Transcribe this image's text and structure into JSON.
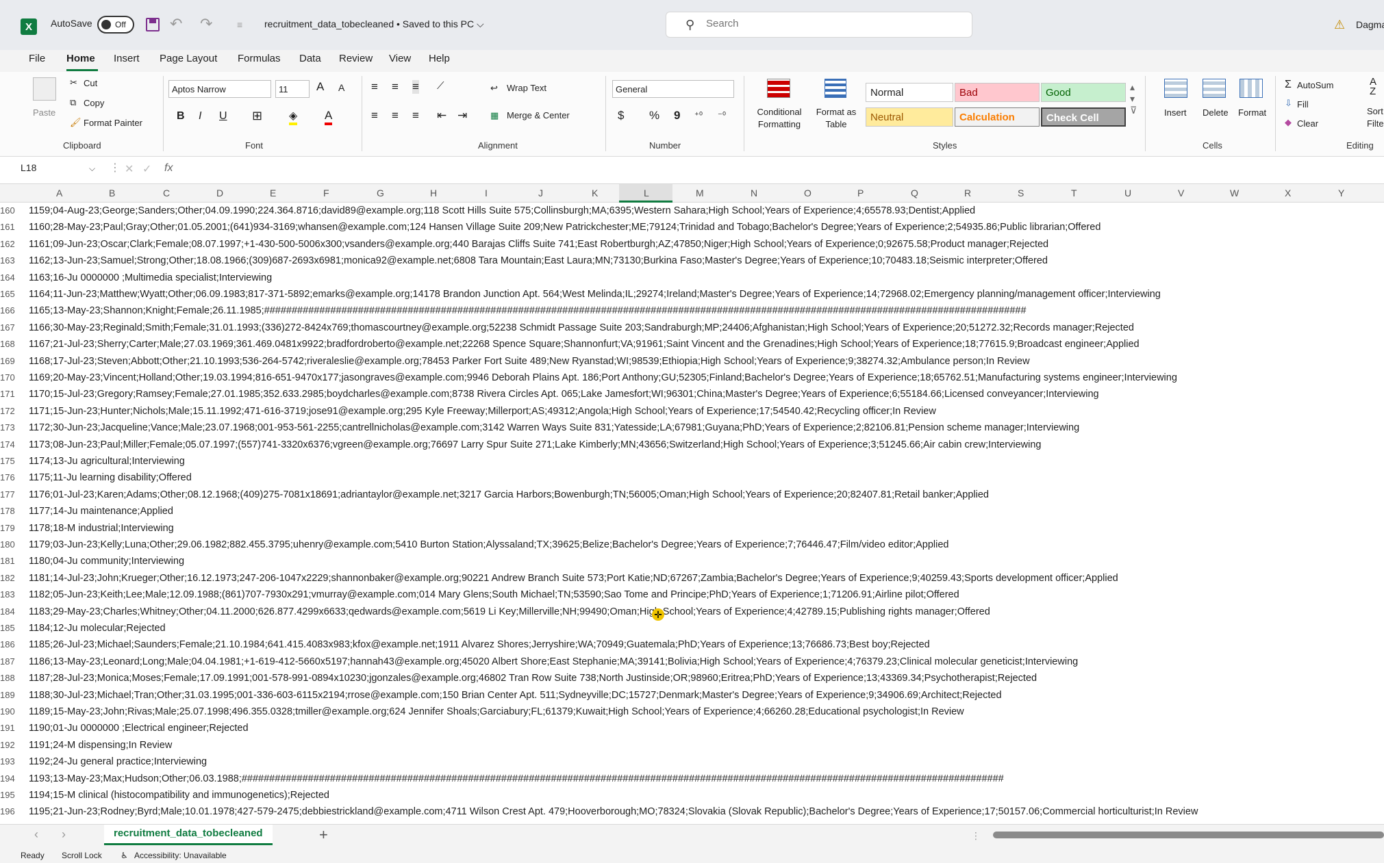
{
  "titlebar": {
    "app_icon": "X",
    "autosave": "AutoSave",
    "toggle": "Off",
    "doc_title": "recruitment_data_tobecleaned • Saved to this PC ⌵",
    "search_placeholder": "Search",
    "user": "Dagma",
    "warning_icon": "warning-icon"
  },
  "menu": [
    "File",
    "Home",
    "Insert",
    "Page Layout",
    "Formulas",
    "Data",
    "Review",
    "View",
    "Help"
  ],
  "ribbon": {
    "clipboard": {
      "paste": "Paste",
      "cut": "Cut",
      "copy": "Copy",
      "format_painter": "Format Painter",
      "label": "Clipboard"
    },
    "font": {
      "name": "Aptos Narrow",
      "size": "11",
      "label": "Font",
      "bold": "B",
      "italic": "I",
      "underline": "U",
      "grow": "A",
      "shrink": "A"
    },
    "alignment": {
      "wrap": "Wrap Text",
      "merge": "Merge & Center",
      "label": "Alignment"
    },
    "number": {
      "format": "General",
      "label": "Number",
      "currency": "$",
      "percent": "%",
      "comma": "9"
    },
    "styles": {
      "conditional": "Conditional Formatting",
      "table": "Format as Table",
      "normal": "Normal",
      "bad": "Bad",
      "good": "Good",
      "neutral": "Neutral",
      "calculation": "Calculation",
      "check": "Check Cell",
      "label": "Styles"
    },
    "cells": {
      "insert": "Insert",
      "delete": "Delete",
      "format": "Format",
      "label": "Cells"
    },
    "editing": {
      "autosum": "AutoSum",
      "fill": "Fill",
      "clear": "Clear",
      "sort": "Sort",
      "filter": "Filte",
      "label": "Editing"
    }
  },
  "formula": {
    "namebox": "L18",
    "fx": "fx",
    "value": ""
  },
  "columns": [
    "A",
    "B",
    "C",
    "D",
    "E",
    "F",
    "G",
    "H",
    "I",
    "J",
    "K",
    "L",
    "M",
    "N",
    "O",
    "P",
    "Q",
    "R",
    "S",
    "T",
    "U",
    "V",
    "W",
    "X",
    "Y"
  ],
  "rows": [
    {
      "n": "160",
      "t": "1159;04-Aug-23;George;Sanders;Other;04.09.1990;224.364.8716;david89@example.org;118 Scott Hills Suite 575;Collinsburgh;MA;6395;Western Sahara;High School;Years of Experience;4;65578.93;Dentist;Applied"
    },
    {
      "n": "161",
      "t": "1160;28-May-23;Paul;Gray;Other;01.05.2001;(641)934-3169;whansen@example.com;124 Hansen Village Suite 209;New Patrickchester;ME;79124;Trinidad and Tobago;Bachelor's Degree;Years of Experience;2;54935.86;Public librarian;Offered"
    },
    {
      "n": "162",
      "t": "1161;09-Jun-23;Oscar;Clark;Female;08.07.1997;+1-430-500-5006x300;vsanders@example.org;440 Barajas Cliffs Suite 741;East Robertburgh;AZ;47850;Niger;High School;Years of Experience;0;92675.58;Product manager;Rejected"
    },
    {
      "n": "163",
      "t": "1162;13-Jun-23;Samuel;Strong;Other;18.08.1966;(309)687-2693x6981;monica92@example.net;6808 Tara Mountain;East Laura;MN;73130;Burkina Faso;Master's Degree;Years of Experience;10;70483.18;Seismic interpreter;Offered"
    },
    {
      "n": "164",
      "t": "1163;16-Ju 0000000 ;Multimedia specialist;Interviewing"
    },
    {
      "n": "165",
      "t": "1164;11-Jun-23;Matthew;Wyatt;Other;06.09.1983;817-371-5892;emarks@example.org;14178 Brandon Junction Apt. 564;West Melinda;IL;29274;Ireland;Master's Degree;Years of Experience;14;72968.02;Emergency planning/management officer;Interviewing"
    },
    {
      "n": "166",
      "t": "1165;13-May-23;Shannon;Knight;Female;26.11.1985;##########################################################################################################################################"
    },
    {
      "n": "167",
      "t": "1166;30-May-23;Reginald;Smith;Female;31.01.1993;(336)272-8424x769;thomascourtney@example.org;52238 Schmidt Passage Suite 203;Sandraburgh;MP;24406;Afghanistan;High School;Years of Experience;20;51272.32;Records manager;Rejected"
    },
    {
      "n": "168",
      "t": "1167;21-Jul-23;Sherry;Carter;Male;27.03.1969;361.469.0481x9922;bradfordroberto@example.net;22268 Spence Square;Shannonfurt;VA;91961;Saint Vincent and the Grenadines;High School;Years of Experience;18;77615.9;Broadcast engineer;Applied"
    },
    {
      "n": "169",
      "t": "1168;17-Jul-23;Steven;Abbott;Other;21.10.1993;536-264-5742;riveraleslie@example.org;78453 Parker Fort Suite 489;New Ryanstad;WI;98539;Ethiopia;High School;Years of Experience;9;38274.32;Ambulance person;In Review"
    },
    {
      "n": "170",
      "t": "1169;20-May-23;Vincent;Holland;Other;19.03.1994;816-651-9470x177;jasongraves@example.com;9946 Deborah Plains Apt. 186;Port Anthony;GU;52305;Finland;Bachelor's Degree;Years of Experience;18;65762.51;Manufacturing systems engineer;Interviewing"
    },
    {
      "n": "171",
      "t": "1170;15-Jul-23;Gregory;Ramsey;Female;27.01.1985;352.633.2985;boydcharles@example.com;8738 Rivera Circles Apt. 065;Lake Jamesfort;WI;96301;China;Master's Degree;Years of Experience;6;55184.66;Licensed conveyancer;Interviewing"
    },
    {
      "n": "172",
      "t": "1171;15-Jun-23;Hunter;Nichols;Male;15.11.1992;471-616-3719;jose91@example.org;295 Kyle Freeway;Millerport;AS;49312;Angola;High School;Years of Experience;17;54540.42;Recycling officer;In Review"
    },
    {
      "n": "173",
      "t": "1172;30-Jun-23;Jacqueline;Vance;Male;23.07.1968;001-953-561-2255;cantrellnicholas@example.com;3142 Warren Ways Suite 831;Yatesside;LA;67981;Guyana;PhD;Years of Experience;2;82106.81;Pension scheme manager;Interviewing"
    },
    {
      "n": "174",
      "t": "1173;08-Jun-23;Paul;Miller;Female;05.07.1997;(557)741-3320x6376;vgreen@example.org;76697 Larry Spur Suite 271;Lake Kimberly;MN;43656;Switzerland;High School;Years of Experience;3;51245.66;Air cabin crew;Interviewing"
    },
    {
      "n": "175",
      "t": "1174;13-Ju agricultural;Interviewing"
    },
    {
      "n": "176",
      "t": "1175;11-Ju learning disability;Offered"
    },
    {
      "n": "177",
      "t": "1176;01-Jul-23;Karen;Adams;Other;08.12.1968;(409)275-7081x18691;adriantaylor@example.net;3217 Garcia Harbors;Bowenburgh;TN;56005;Oman;High School;Years of Experience;20;82407.81;Retail banker;Applied"
    },
    {
      "n": "178",
      "t": "1177;14-Ju maintenance;Applied"
    },
    {
      "n": "179",
      "t": "1178;18-M industrial;Interviewing"
    },
    {
      "n": "180",
      "t": "1179;03-Jun-23;Kelly;Luna;Other;29.06.1982;882.455.3795;uhenry@example.com;5410 Burton Station;Alyssaland;TX;39625;Belize;Bachelor's Degree;Years of Experience;7;76446.47;Film/video editor;Applied"
    },
    {
      "n": "181",
      "t": "1180;04-Ju community;Interviewing"
    },
    {
      "n": "182",
      "t": "1181;14-Jul-23;John;Krueger;Other;16.12.1973;247-206-1047x2229;shannonbaker@example.org;90221 Andrew Branch Suite 573;Port Katie;ND;67267;Zambia;Bachelor's Degree;Years of Experience;9;40259.43;Sports development officer;Applied"
    },
    {
      "n": "183",
      "t": "1182;05-Jun-23;Keith;Lee;Male;12.09.1988;(861)707-7930x291;vmurray@example.com;014 Mary Glens;South Michael;TN;53590;Sao Tome and Principe;PhD;Years of Experience;1;71206.91;Airline pilot;Offered"
    },
    {
      "n": "184",
      "t": "1183;29-May-23;Charles;Whitney;Other;04.11.2000;626.877.4299x6633;qedwards@example.com;5619 Li Key;Millerville;NH;99490;Oman;High School;Years of Experience;4;42789.15;Publishing rights manager;Offered"
    },
    {
      "n": "185",
      "t": "1184;12-Ju molecular;Rejected"
    },
    {
      "n": "186",
      "t": "1185;26-Jul-23;Michael;Saunders;Female;21.10.1984;641.415.4083x983;kfox@example.net;1911 Alvarez Shores;Jerryshire;WA;70949;Guatemala;PhD;Years of Experience;13;76686.73;Best boy;Rejected"
    },
    {
      "n": "187",
      "t": "1186;13-May-23;Leonard;Long;Male;04.04.1981;+1-619-412-5660x5197;hannah43@example.org;45020 Albert Shore;East Stephanie;MA;39141;Bolivia;High School;Years of Experience;4;76379.23;Clinical molecular geneticist;Interviewing"
    },
    {
      "n": "188",
      "t": "1187;28-Jul-23;Monica;Moses;Female;17.09.1991;001-578-991-0894x10230;jgonzales@example.org;46802 Tran Row Suite 738;North Justinside;OR;98960;Eritrea;PhD;Years of Experience;13;43369.34;Psychotherapist;Rejected"
    },
    {
      "n": "189",
      "t": "1188;30-Jul-23;Michael;Tran;Other;31.03.1995;001-336-603-6115x2194;rrose@example.com;150 Brian Center Apt. 511;Sydneyville;DC;15727;Denmark;Master's Degree;Years of Experience;9;34906.69;Architect;Rejected"
    },
    {
      "n": "190",
      "t": "1189;15-May-23;John;Rivas;Male;25.07.1998;496.355.0328;tmiller@example.org;624 Jennifer Shoals;Garciabury;FL;61379;Kuwait;High School;Years of Experience;4;66260.28;Educational psychologist;In Review"
    },
    {
      "n": "191",
      "t": "1190;01-Ju 0000000 ;Electrical engineer;Rejected"
    },
    {
      "n": "192",
      "t": "1191;24-M dispensing;In Review"
    },
    {
      "n": "193",
      "t": "1192;24-Ju general practice;Interviewing"
    },
    {
      "n": "194",
      "t": "1193;13-May-23;Max;Hudson;Other;06.03.1988;##########################################################################################################################################"
    },
    {
      "n": "195",
      "t": "1194;15-M clinical (histocompatibility and immunogenetics);Rejected"
    },
    {
      "n": "196",
      "t": "1195;21-Jun-23;Rodney;Byrd;Male;10.01.1978;427-579-2475;debbiestrickland@example.com;4711 Wilson Crest Apt. 479;Hooverborough;MO;78324;Slovakia (Slovak Republic);Bachelor's Degree;Years of Experience;17;50157.06;Commercial horticulturist;In Review"
    }
  ],
  "sheet": {
    "tab": "recruitment_data_tobecleaned",
    "add": "+"
  },
  "status": {
    "ready": "Ready",
    "scroll": "Scroll Lock",
    "access": "Accessibility: Unavailable"
  }
}
